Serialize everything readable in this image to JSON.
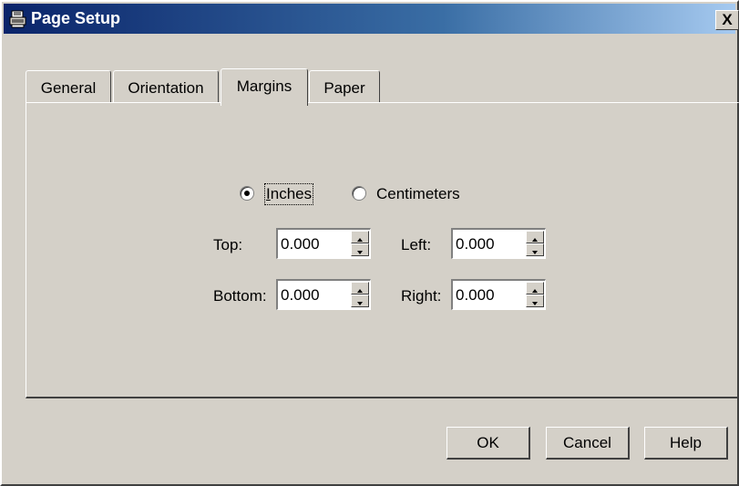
{
  "window": {
    "title": "Page Setup",
    "close_label": "X"
  },
  "tabs": [
    {
      "label": "General"
    },
    {
      "label": "Orientation"
    },
    {
      "label": "Margins",
      "active": true
    },
    {
      "label": "Paper"
    }
  ],
  "units": {
    "inches_label": "Inches",
    "centimeters_label": "Centimeters",
    "selected": "Inches"
  },
  "margins": {
    "top_label": "Top:",
    "top_value": "0.000",
    "left_label": "Left:",
    "left_value": "0.000",
    "bottom_label": "Bottom:",
    "bottom_value": "0.000",
    "right_label": "Right:",
    "right_value": "0.000"
  },
  "buttons": {
    "ok": "OK",
    "cancel": "Cancel",
    "help": "Help"
  },
  "icons": {
    "app": "printer-icon",
    "close": "close-icon",
    "spin_up": "arrow-up-icon",
    "spin_down": "arrow-down-icon"
  },
  "colors": {
    "titlebar": "#0a246a",
    "face": "#d4d0c8"
  }
}
